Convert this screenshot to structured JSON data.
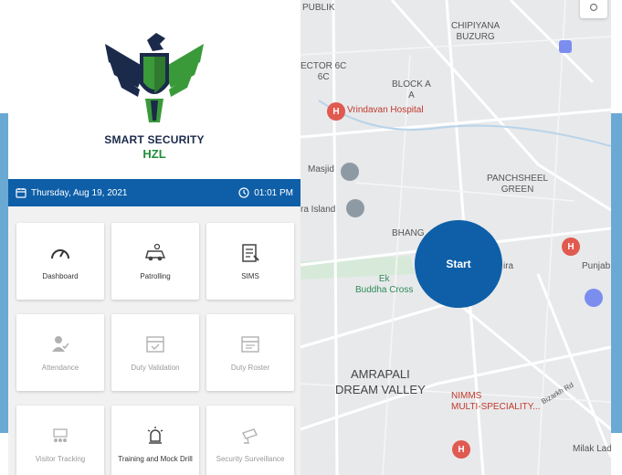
{
  "brand": {
    "title": "SMART SECURITY",
    "subtitle": "HZL",
    "colors": {
      "navy": "#1b2a4a",
      "green": "#1f8f3a",
      "blue": "#0e5fa8"
    }
  },
  "datebar": {
    "date": "Thursday, Aug 19, 2021",
    "time": "01:01 PM",
    "calendar_icon": "calendar-icon",
    "clock_icon": "clock-icon"
  },
  "tiles": [
    {
      "label": "Dashboard",
      "icon": "speedometer-icon",
      "enabled": true
    },
    {
      "label": "Patrolling",
      "icon": "patrol-car-icon",
      "enabled": true
    },
    {
      "label": "SIMS",
      "icon": "document-icon",
      "enabled": true
    },
    {
      "label": "Attendance",
      "icon": "user-check-icon",
      "enabled": false
    },
    {
      "label": "Duty Validation",
      "icon": "calendar-check-icon",
      "enabled": false
    },
    {
      "label": "Duty Roster",
      "icon": "calendar-list-icon",
      "enabled": false
    },
    {
      "label": "Visitor Tracking",
      "icon": "visitor-icon",
      "enabled": false
    },
    {
      "label": "Training and Mock Drill",
      "icon": "alarm-icon",
      "enabled": true
    },
    {
      "label": "Security Surveillance",
      "icon": "cctv-icon",
      "enabled": false
    }
  ],
  "map": {
    "start_label": "Start",
    "labels": {
      "publik": "PUBLIK",
      "chipiyana1": "CHIPIYANA",
      "chipiyana2": "BUZURG",
      "sector1": "ECTOR 6C",
      "sector2": "6C",
      "blocka1": "BLOCK A",
      "blocka2": "A",
      "hospital": "Vrindavan Hospital",
      "masjid": "Masjid",
      "island": "ra Island",
      "panchsheel1": "PANCHSHEEL",
      "panchsheel2": "GREEN",
      "bhang": "BHANG",
      "ira": "ira",
      "punjab": "Punjab",
      "ek1": "Ek",
      "ek2": "Buddha Cross",
      "amrapali1": "AMRAPALI",
      "amrapali2": "DREAM VALLEY",
      "nimms1": "NIMMS",
      "nimms2": "MULTI-SPECIALITY...",
      "bizarkh": "Bizarkh Rd",
      "milak": "Milak Lad"
    }
  }
}
